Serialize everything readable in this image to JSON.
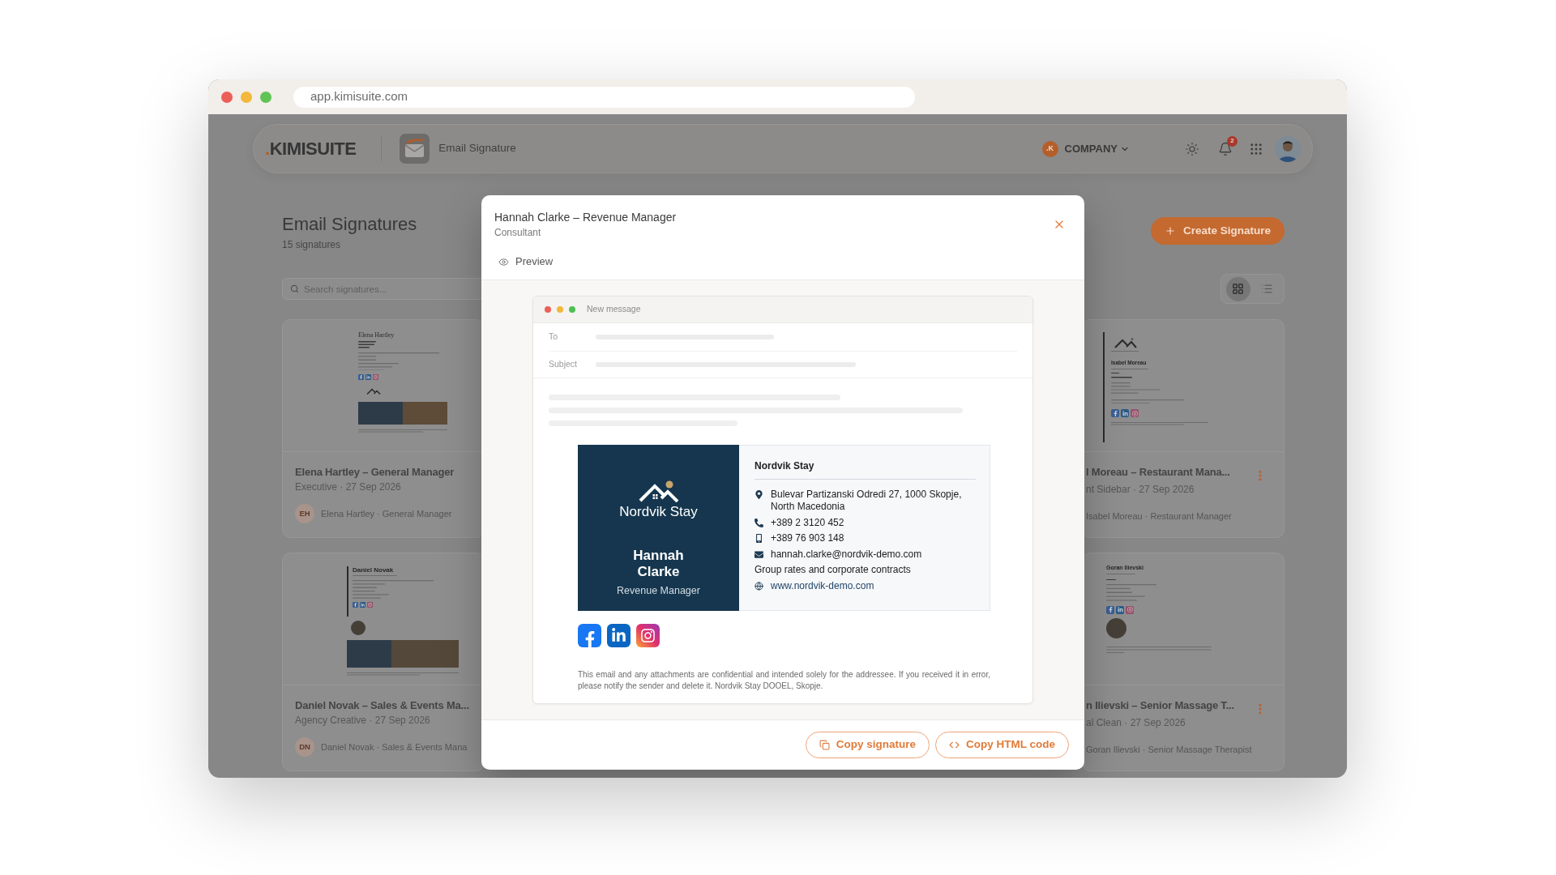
{
  "browser": {
    "url": "app.kimisuite.com"
  },
  "header": {
    "logo": {
      "dot": ".",
      "text": "KIMISUITE"
    },
    "app_name": "Email Signature",
    "company": {
      "badge": ".K",
      "label": "COMPANY"
    },
    "notification_count": "2"
  },
  "page": {
    "title": "Email Signatures",
    "count": "15 signatures",
    "search": {
      "placeholder": "Search signatures..."
    },
    "create_button": "Create Signature",
    "views": [
      {
        "kind": "grid",
        "selected": true
      },
      {
        "kind": "list",
        "selected": false
      }
    ]
  },
  "cards": [
    {
      "title": "Elena Hartley – General Manager",
      "meta": "Executive · 27 Sep 2026",
      "initials": "EH",
      "owner": "Elena Hartley · General Manager",
      "thumbnail": {
        "kind": "logo_banner",
        "name": "Elena Hartley"
      }
    },
    {
      "title": "l Moreau – Restaurant Mana...",
      "meta": "nt Sidebar · 27 Sep 2026",
      "owner": "Isabel Moreau · Restaurant Manager",
      "thumbnail": {
        "kind": "sidebar_logo",
        "name": "Isabel Moreau"
      }
    },
    {
      "title": "Daniel Novak – Sales & Events Ma...",
      "meta": "Agency Creative · 27 Sep 2026",
      "initials": "DN",
      "owner": "Daniel Novak · Sales & Events Mana",
      "thumbnail": {
        "kind": "photo_banner",
        "name": "Daniel Novak"
      }
    },
    {
      "title": "n Ilievski – Senior Massage T...",
      "meta": "al Clean · 27 Sep 2026",
      "owner": "Goran Ilievski · Senior Massage Therapist",
      "thumbnail": {
        "kind": "photo",
        "name": "Goran Ilievski"
      }
    }
  ],
  "modal": {
    "title": "Hannah Clarke – Revenue Manager",
    "subtitle": "Consultant",
    "tab": "Preview",
    "email": {
      "window_title": "New message",
      "fields": [
        {
          "label": "To"
        },
        {
          "label": "Subject"
        }
      ]
    },
    "signature": {
      "brand": "Nordvik Stay",
      "name": "Hannah Clarke",
      "role": "Revenue Manager",
      "company": "Nordvik Stay",
      "contacts": [
        {
          "kind": "address",
          "text": "Bulevar Partizanski Odredi 27, 1000 Skopje, North Macedonia"
        },
        {
          "kind": "phone",
          "text": "+389 2 3120 452"
        },
        {
          "kind": "mobile",
          "text": "+389 76 903 148"
        },
        {
          "kind": "email",
          "text": "hannah.clarke@nordvik-demo.com"
        },
        {
          "kind": "note",
          "text": "Group rates and corporate contracts"
        },
        {
          "kind": "website",
          "text": "www.nordvik-demo.com"
        }
      ],
      "socials": [
        {
          "kind": "facebook"
        },
        {
          "kind": "linkedin"
        },
        {
          "kind": "instagram"
        }
      ],
      "disclaimer": "This email and any attachments are confidential and intended solely for the addressee. If you received it in error, please notify the sender and delete it. Nordvik Stay DOOEL, Skopje."
    },
    "buttons": [
      {
        "kind": "copy",
        "label": "Copy signature"
      },
      {
        "kind": "code",
        "label": "Copy HTML code"
      }
    ]
  }
}
